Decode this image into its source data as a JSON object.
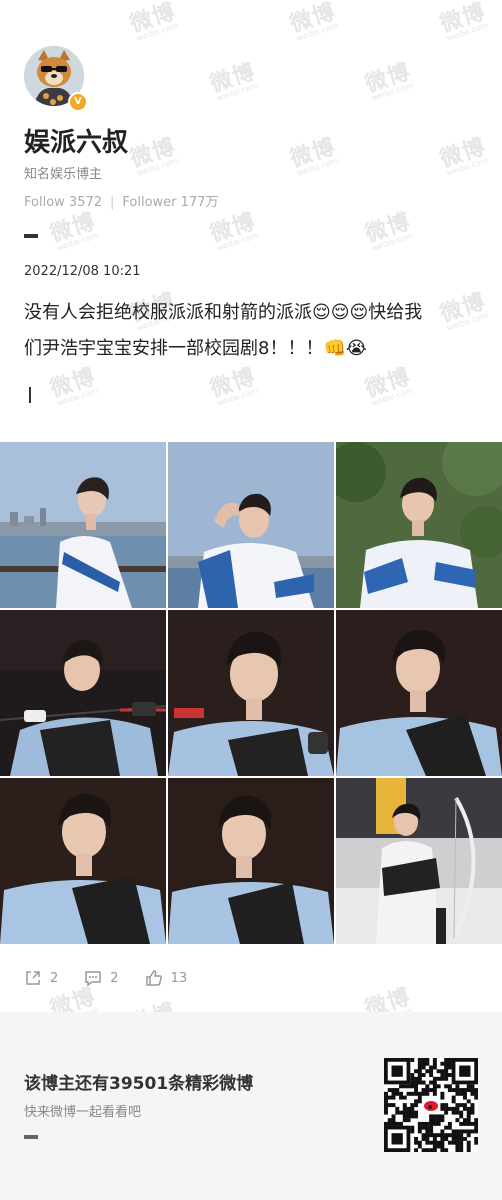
{
  "profile": {
    "name": "娱派六叔",
    "subtitle": "知名娱乐博主",
    "follow_label": "Follow",
    "follow_count": "3572",
    "follower_label": "Follower",
    "follower_count": "177万",
    "verified_icon": "verified-badge-icon"
  },
  "post": {
    "date": "2022/12/08 10:21",
    "text_line1": "没有人会拒绝校服派派和射箭的派派😌😌😌快给我",
    "text_line2": "们尹浩宇宝宝安排一部校园剧8！！！👊😭",
    "photo_count": 9
  },
  "actions": {
    "repost_count": "2",
    "comment_count": "2",
    "like_count": "13"
  },
  "footer": {
    "title": "该博主还有39501条精彩微博",
    "subtitle": "快来微博一起看看吧"
  },
  "watermark": {
    "text": "微博",
    "sub": "weibo.com"
  },
  "colors": {
    "accent_badge": "#f5a623",
    "footer_bg": "#f5f5f5"
  }
}
